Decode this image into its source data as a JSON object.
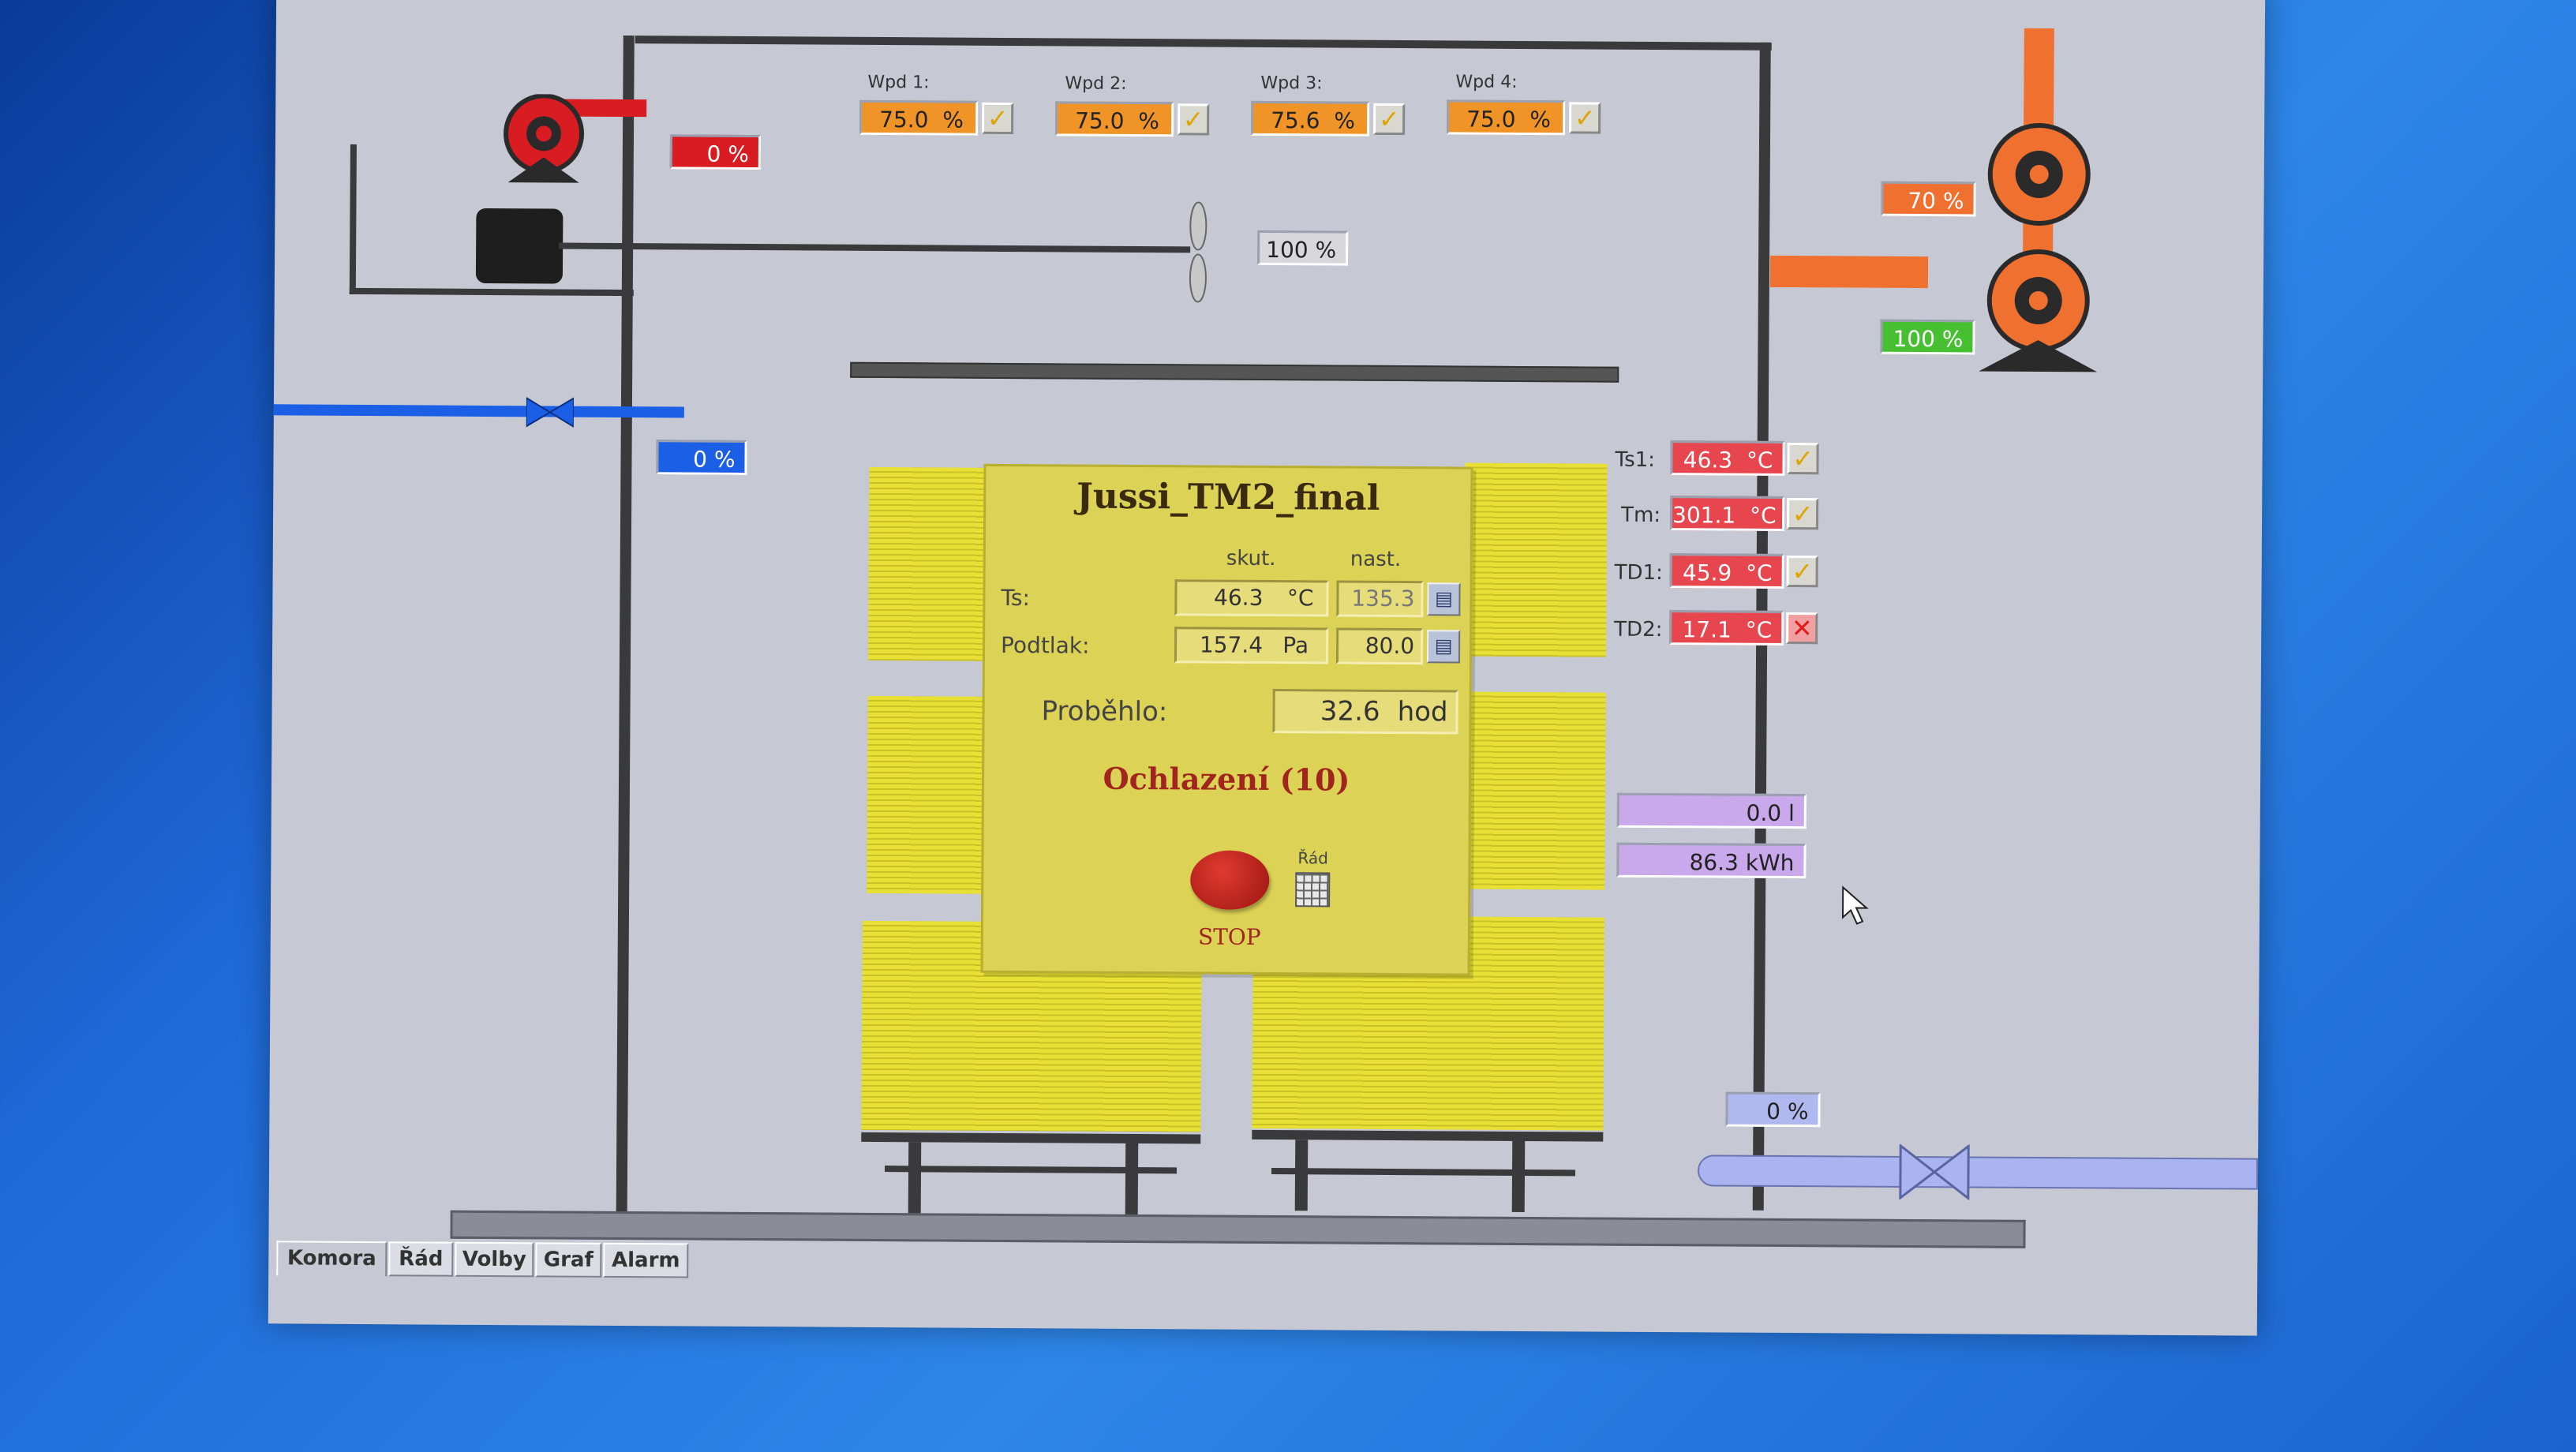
{
  "tabs": [
    {
      "label": "Komora"
    },
    {
      "label": "Řád"
    },
    {
      "label": "Volby"
    },
    {
      "label": "Graf"
    },
    {
      "label": "Alarm"
    }
  ],
  "valves": [
    {
      "label": "Wpd 1:",
      "value": "75.0",
      "unit": "%"
    },
    {
      "label": "Wpd 2:",
      "value": "75.0",
      "unit": "%"
    },
    {
      "label": "Wpd 3:",
      "value": "75.6",
      "unit": "%"
    },
    {
      "label": "Wpd 4:",
      "value": "75.0",
      "unit": "%"
    }
  ],
  "left_fan": {
    "value": "0 %",
    "color": "#d81c22"
  },
  "circ_fan": {
    "value": "100 %"
  },
  "water_valve": {
    "value": "0 %",
    "color": "#1a5fe6"
  },
  "right_pump": {
    "top_value": "70 %",
    "bottom_value": "100 %",
    "top_color": "#f07030",
    "bottom_color": "#46c030"
  },
  "sensors": [
    {
      "label": "Ts1:",
      "value": "46.3",
      "unit": "°C",
      "ok": true
    },
    {
      "label": "Tm:",
      "value": "301.1",
      "unit": "°C",
      "ok": true
    },
    {
      "label": "TD1:",
      "value": "45.9",
      "unit": "°C",
      "ok": true
    },
    {
      "label": "TD2:",
      "value": "17.1",
      "unit": "°C",
      "ok": false
    }
  ],
  "meters": [
    {
      "value": "0.0 l"
    },
    {
      "value": "86.3 kWh"
    }
  ],
  "bottom_valve": {
    "value": "0 %"
  },
  "panel": {
    "title": "Jussi_TM2_final",
    "col_actual": "skut.",
    "col_set": "nast.",
    "ts_label": "Ts:",
    "ts_actual": "46.3",
    "ts_unit": "°C",
    "ts_set": "135.3",
    "podtlak_label": "Podtlak:",
    "podtlak_actual": "157.4",
    "podtlak_unit": "Pa",
    "podtlak_set": "80.0",
    "elapsed_label": "Proběhlo:",
    "elapsed_value": "32.6",
    "elapsed_unit": "hod",
    "phase": "Ochlazení (10)",
    "stop_label": "STOP",
    "rad_label": "Řád"
  },
  "colors": {
    "alarm_red": "#e8464e",
    "valve_orange": "#f09428",
    "meter_purple": "#c9a8ec",
    "stack_yellow": "#e8e035"
  }
}
